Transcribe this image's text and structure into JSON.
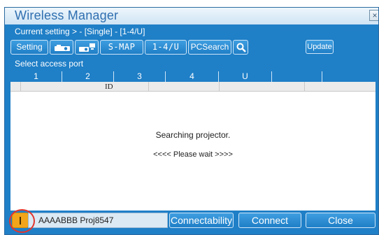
{
  "window": {
    "title": "Wireless Manager",
    "close_glyph": "×"
  },
  "status": {
    "current_setting": "Current setting > - [Single] - [1-4/U]"
  },
  "toolbar": {
    "setting_label": "Setting",
    "icon1": "projector-icon",
    "icon2": "network-projector-icon",
    "smap_label": "S-MAP",
    "range_label": "1-4/U",
    "pcsearch_label": "PCSearch",
    "search_icon": "magnifier-icon",
    "update_label": "Update"
  },
  "ports": {
    "label": "Select access port",
    "tabs": [
      "1",
      "2",
      "3",
      "4",
      "U",
      ""
    ]
  },
  "list": {
    "id_header": "ID",
    "message": "Searching projector.",
    "wait": "<<<< Please wait >>>>"
  },
  "bottom": {
    "projector_name": "AAAABBB Proj8547",
    "connectability_label": "Connectability",
    "connect_label": "Connect",
    "close_label": "Close"
  },
  "colors": {
    "window_blue": "#1f7fc7",
    "warning": "#f2a51a",
    "highlight_ring": "#e2352e"
  }
}
